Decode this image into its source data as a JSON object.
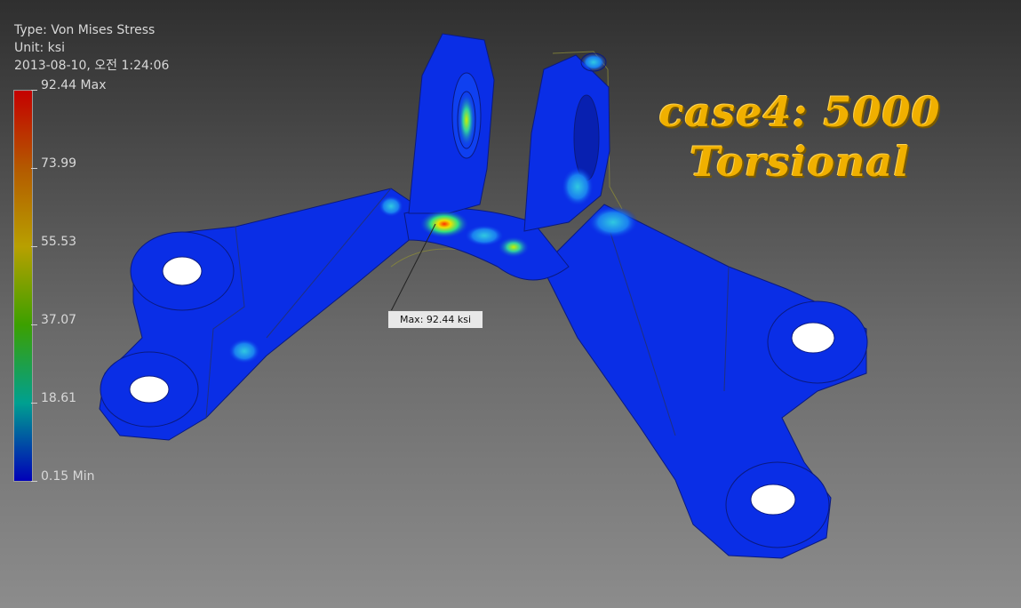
{
  "info": {
    "type_line": "Type: Von Mises Stress",
    "unit_line": "Unit: ksi",
    "timestamp_line": "2013-08-10, 오전 1:24:06"
  },
  "legend": {
    "labels": [
      "92.44 Max",
      "73.99",
      "55.53",
      "37.07",
      "18.61",
      "0.15 Min"
    ],
    "colors": [
      "#c40000",
      "#b45a00",
      "#b8a000",
      "#3ca000",
      "#00a090",
      "#0000b8"
    ]
  },
  "annotation": {
    "max_label": "Max: 92.44 ksi"
  },
  "title": {
    "line1": "case4: 5000",
    "line2": "Torsional"
  },
  "colors": {
    "part_blue": "#0a2ee6",
    "title_gold": "#f0b000"
  }
}
